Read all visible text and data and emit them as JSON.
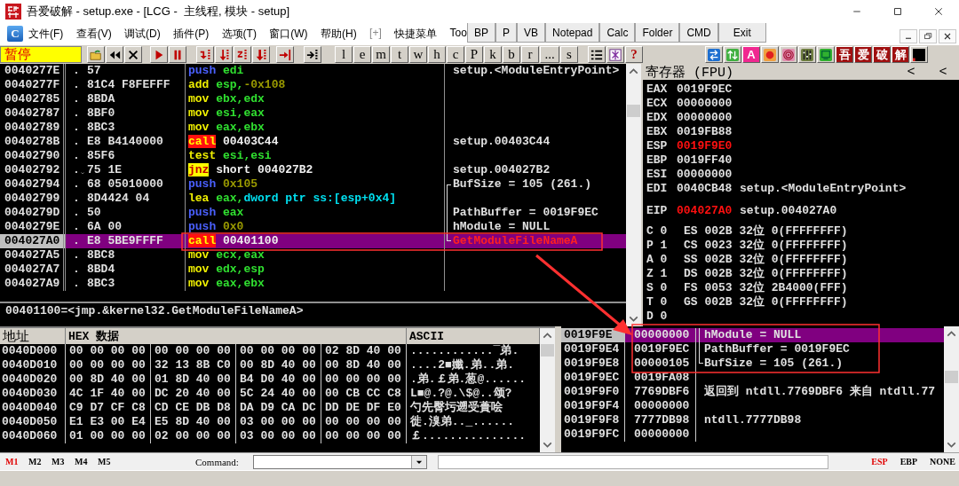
{
  "window": {
    "title": "吾爱破解 - setup.exe - [LCG -  主线程, 模块 - setup]"
  },
  "menu": {
    "logo": "C",
    "items": [
      {
        "label": "文件(F)",
        "disabled": false
      },
      {
        "label": "查看(V)",
        "disabled": false
      },
      {
        "label": "调试(D)",
        "disabled": false
      },
      {
        "label": "插件(P)",
        "disabled": false
      },
      {
        "label": "选项(T)",
        "disabled": false
      },
      {
        "label": "窗口(W)",
        "disabled": false
      },
      {
        "label": "帮助(H)",
        "disabled": false
      },
      {
        "label": "[+]",
        "disabled": true
      },
      {
        "label": "快捷菜单",
        "disabled": false
      },
      {
        "label": "Too",
        "disabled": false
      }
    ],
    "plugin_buttons": [
      "BP",
      "P",
      "VB",
      "Notepad",
      "Calc",
      "Folder",
      "CMD",
      "Exit"
    ]
  },
  "toolbar": {
    "status": "暂停",
    "letter_buttons": [
      "l",
      "e",
      "m",
      "t",
      "w",
      "h",
      "c",
      "P",
      "k",
      "b",
      "r",
      "...",
      "s"
    ],
    "help": "?",
    "tool_letter": "A",
    "brand_letters": [
      "吾",
      "爱",
      "破",
      "解"
    ]
  },
  "disassembly": {
    "rows": [
      {
        "address": "0040277E",
        "marker": ".",
        "jump": false,
        "hex": "57",
        "tokens": [
          {
            "text": "push",
            "kind": "stack"
          },
          {
            "text": " edi",
            "kind": "register"
          }
        ],
        "comment": "setup.<ModuleEntryPoint>",
        "api": false,
        "bracketed": false,
        "selected": false
      },
      {
        "address": "0040277F",
        "marker": ".",
        "jump": false,
        "hex": "81C4 F8FEFFF",
        "tokens": [
          {
            "text": "add",
            "kind": "mnemonic"
          },
          {
            "text": " esp,",
            "kind": "register"
          },
          {
            "text": "-0x108",
            "kind": "immediate"
          }
        ],
        "bracketed": false,
        "selected": false
      },
      {
        "address": "00402785",
        "marker": ".",
        "jump": false,
        "hex": "8BDA",
        "tokens": [
          {
            "text": "mov",
            "kind": "mnemonic"
          },
          {
            "text": " ebx,edx",
            "kind": "register"
          }
        ],
        "bracketed": false,
        "selected": false
      },
      {
        "address": "00402787",
        "marker": ".",
        "jump": false,
        "hex": "8BF0",
        "tokens": [
          {
            "text": "mov",
            "kind": "mnemonic"
          },
          {
            "text": " esi,eax",
            "kind": "register"
          }
        ],
        "bracketed": false,
        "selected": false
      },
      {
        "address": "00402789",
        "marker": ".",
        "jump": false,
        "hex": "8BC3",
        "tokens": [
          {
            "text": "mov",
            "kind": "mnemonic"
          },
          {
            "text": " eax,ebx",
            "kind": "register"
          }
        ],
        "bracketed": false,
        "selected": false
      },
      {
        "address": "0040278B",
        "marker": ".",
        "jump": false,
        "hex": "E8 B4140000",
        "tokens": [
          {
            "text": "call",
            "kind": "call"
          },
          {
            "text": " 00403C44",
            "kind": "plain"
          }
        ],
        "comment": "setup.00403C44",
        "api": false,
        "bracketed": false,
        "selected": false
      },
      {
        "address": "00402790",
        "marker": ".",
        "jump": false,
        "hex": "85F6",
        "tokens": [
          {
            "text": "test",
            "kind": "mnemonic"
          },
          {
            "text": " esi,esi",
            "kind": "register"
          }
        ],
        "bracketed": false,
        "selected": false
      },
      {
        "address": "00402792",
        "marker": ".",
        "jump": true,
        "hex": "75 1E",
        "tokens": [
          {
            "text": "jnz",
            "kind": "jump"
          },
          {
            "text": " short 004027B2",
            "kind": "plain"
          }
        ],
        "comment": "setup.004027B2",
        "api": false,
        "bracketed": false,
        "selected": false
      },
      {
        "address": "00402794",
        "marker": ".",
        "jump": false,
        "hex": "68 05010000",
        "tokens": [
          {
            "text": "push",
            "kind": "stack"
          },
          {
            "text": " 0x105",
            "kind": "immediate"
          }
        ],
        "comment": "BufSize = 105 (261.)",
        "api": false,
        "bracketed": true,
        "selected": false
      },
      {
        "address": "00402799",
        "marker": ".",
        "jump": false,
        "hex": "8D4424 04",
        "tokens": [
          {
            "text": "lea",
            "kind": "mnemonic"
          },
          {
            "text": " eax,",
            "kind": "register"
          },
          {
            "text": "dword ptr ss:[esp+0x4]",
            "kind": "memory"
          }
        ],
        "bracketed": true,
        "selected": false
      },
      {
        "address": "0040279D",
        "marker": ".",
        "jump": false,
        "hex": "50",
        "tokens": [
          {
            "text": "push",
            "kind": "stack"
          },
          {
            "text": " eax",
            "kind": "register"
          }
        ],
        "comment": "PathBuffer = 0019F9EC",
        "api": false,
        "bracketed": true,
        "selected": false
      },
      {
        "address": "0040279E",
        "marker": ".",
        "jump": false,
        "hex": "6A 00",
        "tokens": [
          {
            "text": "push",
            "kind": "stack"
          },
          {
            "text": " 0x0",
            "kind": "immediate"
          }
        ],
        "comment": "hModule = NULL",
        "api": false,
        "bracketed": true,
        "selected": false
      },
      {
        "address": "004027A0",
        "marker": ".",
        "jump": false,
        "hex": "E8 5BE9FFFF",
        "tokens": [
          {
            "text": "call",
            "kind": "call"
          },
          {
            "text": " 00401100",
            "kind": "plain"
          }
        ],
        "comment": "GetModuleFileNameA",
        "api": true,
        "bracketed": true,
        "selected": true
      },
      {
        "address": "004027A5",
        "marker": ".",
        "jump": false,
        "hex": "8BC8",
        "tokens": [
          {
            "text": "mov",
            "kind": "mnemonic"
          },
          {
            "text": " ecx,eax",
            "kind": "register"
          }
        ],
        "bracketed": false,
        "selected": false
      },
      {
        "address": "004027A7",
        "marker": ".",
        "jump": false,
        "hex": "8BD4",
        "tokens": [
          {
            "text": "mov",
            "kind": "mnemonic"
          },
          {
            "text": " edx,esp",
            "kind": "register"
          }
        ],
        "bracketed": false,
        "selected": false
      },
      {
        "address": "004027A9",
        "marker": ".",
        "jump": false,
        "hex": "8BC3",
        "tokens": [
          {
            "text": "mov",
            "kind": "mnemonic"
          },
          {
            "text": " eax,ebx",
            "kind": "register"
          }
        ],
        "bracketed": false,
        "selected": false
      }
    ],
    "info": "00401100=<jmp.&kernel32.GetModuleFileNameA>"
  },
  "registers": {
    "title": "寄存器 (FPU)",
    "header_buttons": [
      "<",
      "<"
    ],
    "rows": [
      {
        "name": "EAX",
        "value": "0019F9EC",
        "changed": false
      },
      {
        "name": "ECX",
        "value": "00000000",
        "changed": false
      },
      {
        "name": "EDX",
        "value": "00000000",
        "changed": false
      },
      {
        "name": "EBX",
        "value": "0019FB88",
        "changed": false
      },
      {
        "name": "ESP",
        "value": "0019F9E0",
        "changed": true
      },
      {
        "name": "EBP",
        "value": "0019FF40",
        "changed": false
      },
      {
        "name": "ESI",
        "value": "00000000",
        "changed": false
      },
      {
        "name": "EDI",
        "value": "0040CB48",
        "changed": false,
        "note": "setup.<ModuleEntryPoint>"
      }
    ],
    "eip": {
      "name": "EIP",
      "value": "004027A0",
      "changed": true,
      "note": "setup.004027A0"
    },
    "flags": [
      {
        "flag": "C 0",
        "segment": "ES 002B 32位 0(FFFFFFFF)"
      },
      {
        "flag": "P 1",
        "segment": "CS 0023 32位 0(FFFFFFFF)"
      },
      {
        "flag": "A 0",
        "segment": "SS 002B 32位 0(FFFFFFFF)"
      },
      {
        "flag": "Z 1",
        "segment": "DS 002B 32位 0(FFFFFFFF)"
      },
      {
        "flag": "S 0",
        "segment": "FS 0053 32位 2B4000(FFF)"
      },
      {
        "flag": "T 0",
        "segment": "GS 002B 32位 0(FFFFFFFF)"
      },
      {
        "flag": "D 0"
      }
    ]
  },
  "dump": {
    "columns": [
      "地址",
      "HEX 数据",
      "ASCII"
    ],
    "rows": [
      {
        "address": "0040D000",
        "bytes": [
          "00 00 00 00",
          "00 00 00 00",
          "00 00 00 00",
          "02 8D 40 00"
        ],
        "ascii": "............‾弟."
      },
      {
        "address": "0040D010",
        "bytes": [
          "00 00 00 00",
          "32 13 8B C0",
          "00 8D 40 00",
          "00 8D 40 00"
        ],
        "ascii": "....2■孅.弟..弟."
      },
      {
        "address": "0040D020",
        "bytes": [
          "00 8D 40 00",
          "01 8D 40 00",
          "B4 D0 40 00",
          "00 00 00 00"
        ],
        "ascii": ".弟.￡弟.葱@......"
      },
      {
        "address": "0040D030",
        "bytes": [
          "4C 1F 40 00",
          "DC 20 40 00",
          "5C 24 40 00",
          "00 CB CC C8"
        ],
        "ascii": "L■@.?@.\\$@..颂?"
      },
      {
        "address": "0040D040",
        "bytes": [
          "C9 D7 CF C8",
          "CD CE DB D8",
          "DA D9 CA DC",
          "DD DE DF E0"
        ],
        "ascii": "勺先臀圬遡受蕢哙"
      },
      {
        "address": "0040D050",
        "bytes": [
          "E1 E3 00 E4",
          "E5 8D 40 00",
          "03 00 00 00",
          "00 00 00 00"
        ],
        "ascii": "徙.溴弟.._......"
      },
      {
        "address": "0040D060",
        "bytes": [
          "01 00 00 00",
          "02 00 00 00",
          "03 00 00 00",
          "00 00 00 00"
        ],
        "ascii": "￡..............."
      }
    ]
  },
  "stack": {
    "rows": [
      {
        "address": "0019F9E",
        "value": "00000000",
        "comment": "hModule = NULL",
        "bracketed": true,
        "selected": true
      },
      {
        "address": "0019F9E4",
        "value": "0019F9EC",
        "comment": "PathBuffer = 0019F9EC",
        "bracketed": true,
        "selected": false
      },
      {
        "address": "0019F9E8",
        "value": "00000105",
        "comment": "BufSize = 105 (261.)",
        "bracketed": true,
        "selected": false
      },
      {
        "address": "0019F9EC",
        "value": "0019FA08",
        "bracketed": false,
        "selected": false
      },
      {
        "address": "0019F9F0",
        "value": "7769DBF6",
        "comment": "返回到 ntdll.7769DBF6 来自 ntdll.77",
        "bracketed": false,
        "selected": false
      },
      {
        "address": "0019F9F4",
        "value": "00000000",
        "bracketed": false,
        "selected": false
      },
      {
        "address": "0019F9F8",
        "value": "7777DB98",
        "comment": "ntdll.7777DB98",
        "bracketed": false,
        "selected": false
      },
      {
        "address": "0019F9FC",
        "value": "00000000",
        "bracketed": false,
        "selected": false
      }
    ]
  },
  "command_bar": {
    "marks": [
      {
        "label": "M1",
        "selected": true
      },
      {
        "label": "M2",
        "selected": false
      },
      {
        "label": "M3",
        "selected": false
      },
      {
        "label": "M4",
        "selected": false
      },
      {
        "label": "M5",
        "selected": false
      }
    ],
    "command_label": "Command:",
    "modes": [
      {
        "label": "ESP",
        "selected": true
      },
      {
        "label": "EBP",
        "selected": false
      },
      {
        "label": "NONE",
        "selected": false
      }
    ]
  }
}
